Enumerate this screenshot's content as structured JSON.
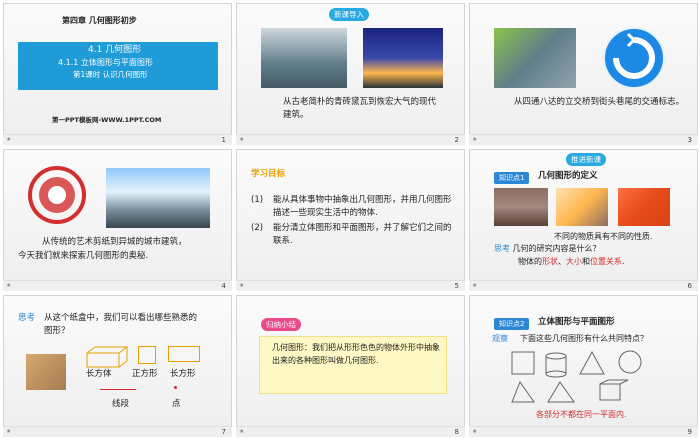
{
  "slides": [
    {
      "num": "1",
      "chapter": "第四章 几何图形初步",
      "title1": "4.1 几何图形",
      "title2": "4.1.1 立体图形与平面图形",
      "title3": "第1课时 认识几何图形",
      "footer": "第一PPT模板网-WWW.1PPT.COM"
    },
    {
      "num": "2",
      "badge": "新课导入",
      "text": "从古老简朴的青砖黛瓦到恢宏大气的现代建筑。"
    },
    {
      "num": "3",
      "text": "从四通八达的立交桥到街头巷尾的交通标志。"
    },
    {
      "num": "4",
      "text1": "从传统的艺术剪纸到异城的城市建筑，",
      "text2": "今天我们就来探索几何图形的奥秘."
    },
    {
      "num": "5",
      "heading": "学习目标",
      "goal1_num": "(1)",
      "goal1": "能从具体事物中抽象出几何图形，并用几何图形描述一些现实生活中的物体.",
      "goal2_num": "(2)",
      "goal2": "能分清立体图形和平面图形，并了解它们之间的联系."
    },
    {
      "num": "6",
      "badge": "推进新课",
      "point": "知识点1",
      "point_title": "几何图形的定义",
      "line1": "不同的物质具有不同的性质.",
      "q_label": "思考",
      "q": "几何的研究内容是什么？",
      "a1": "物体的",
      "a_shape": "形状",
      "a_sep1": "、",
      "a_size": "大小",
      "a_and": "和",
      "a_pos": "位置关系",
      "a_end": "."
    },
    {
      "num": "7",
      "label": "思考",
      "text": "从这个纸盒中，我们可以看出哪些熟悉的图形？",
      "l_cuboid": "长方体",
      "l_square": "正方形",
      "l_rect": "长方形",
      "l_segment": "线段",
      "l_point": "点"
    },
    {
      "num": "8",
      "badge": "归纳小结",
      "text": "几何图形：我们把从形形色色的物体外形中抽象出来的各种图形叫做几何图形."
    },
    {
      "num": "9",
      "point": "知识点2",
      "point_title": "立体图形与平面图形",
      "obs": "观察",
      "q": "下面这些几何图形有什么共同特点？",
      "answer": "各部分不都在同一平面内."
    }
  ],
  "colors": {
    "accent": "#2e86d6",
    "highlight": "#e84a8a",
    "red": "#d62b2b",
    "title_bg": "#1f9bd7"
  },
  "icons": [
    "star-icon",
    "lightbulb-icon",
    "globe-icon"
  ]
}
